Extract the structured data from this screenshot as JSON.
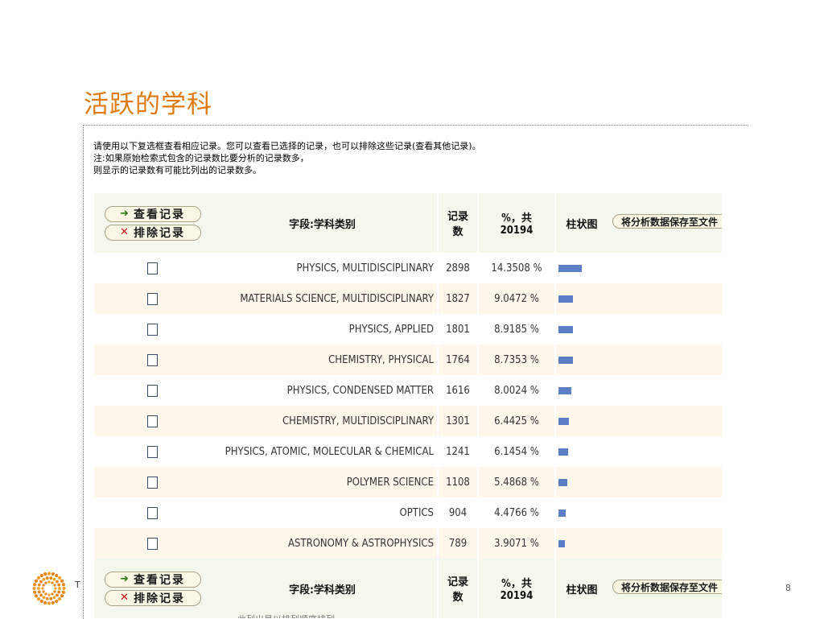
{
  "slide": {
    "title": "活跃的学科",
    "page_number": "8",
    "logo_letter": "T"
  },
  "intro": {
    "line1": "请使用以下复选框查看相应记录。您可以查看已选择的记录，也可以排除这些记录(查看其他记录)。",
    "line2": "注:如果原始检索式包含的记录数比要分析的记录数多，",
    "line3": "则显示的记录数有可能比列出的记录数多。"
  },
  "header": {
    "view_button": "查看记录",
    "exclude_button": "排除记录",
    "field_label": "字段:学科类别",
    "count_label_1": "记录",
    "count_label_2": "数",
    "pct_label_1": "%，共",
    "pct_label_2": "20194",
    "bar_label": "柱状图",
    "save_button": "将分析数据保存至文件"
  },
  "icons": {
    "view": "arrow-right-icon",
    "exclude": "x-mark-icon",
    "arrow_color": "#2e7d1a",
    "x_color": "#d01010",
    "bar_color": "#5b7fc6",
    "title_color": "#e07a10"
  },
  "chart_data": {
    "type": "table",
    "columns": [
      "字段:学科类别",
      "记录数",
      "%，共 20194",
      "柱状图"
    ],
    "categories": [
      "PHYSICS, MULTIDISCIPLINARY",
      "MATERIALS SCIENCE, MULTIDISCIPLINARY",
      "PHYSICS, APPLIED",
      "CHEMISTRY, PHYSICAL",
      "PHYSICS, CONDENSED MATTER",
      "CHEMISTRY, MULTIDISCIPLINARY",
      "PHYSICS, ATOMIC, MOLECULAR & CHEMICAL",
      "POLYMER SCIENCE",
      "OPTICS",
      "ASTRONOMY & ASTROPHYSICS"
    ],
    "counts": [
      2898,
      1827,
      1801,
      1764,
      1616,
      1301,
      1241,
      1108,
      904,
      789
    ],
    "percent_labels": [
      "14.3508 %",
      "9.0472 %",
      "8.9185 %",
      "8.7353 %",
      "8.0024 %",
      "6.4425 %",
      "6.1454 %",
      "5.4868 %",
      "4.4766 %",
      "3.9071 %"
    ],
    "total": 20194
  },
  "footer_clip": "此列出是以排列顺序排列..."
}
